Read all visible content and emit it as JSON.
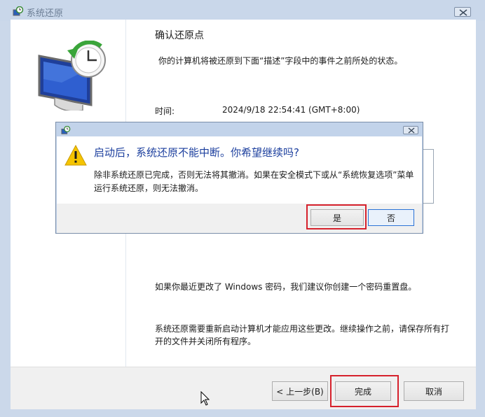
{
  "window": {
    "title": "系统还原"
  },
  "main": {
    "heading": "确认还原点",
    "description": "你的计算机将被还原到下面“描述”字段中的事件之前所处的状态。",
    "time_label": "时间:",
    "time_value": "2024/9/18 22:54:41 (GMT+8:00)",
    "para1": "如果你最近更改了 Windows 密码，我们建议你创建一个密码重置盘。",
    "para2": "系统还原需要重新启动计算机才能应用这些更改。继续操作之前，请保存所有打开的文件并关闭所有程序。"
  },
  "footer": {
    "back_label": "< 上一步(B)",
    "finish_label": "完成",
    "cancel_label": "取消"
  },
  "dialog": {
    "heading": "启动后，系统还原不能中断。你希望继续吗?",
    "text": "除非系统还原已完成，否则无法将其撤消。如果在安全模式下或从“系统恢复选项”菜单运行系统还原，则无法撤消。",
    "yes_label": "是",
    "no_label": "否"
  },
  "colors": {
    "highlight": "#d6212c",
    "dialog_heading": "#1c3f9e"
  }
}
